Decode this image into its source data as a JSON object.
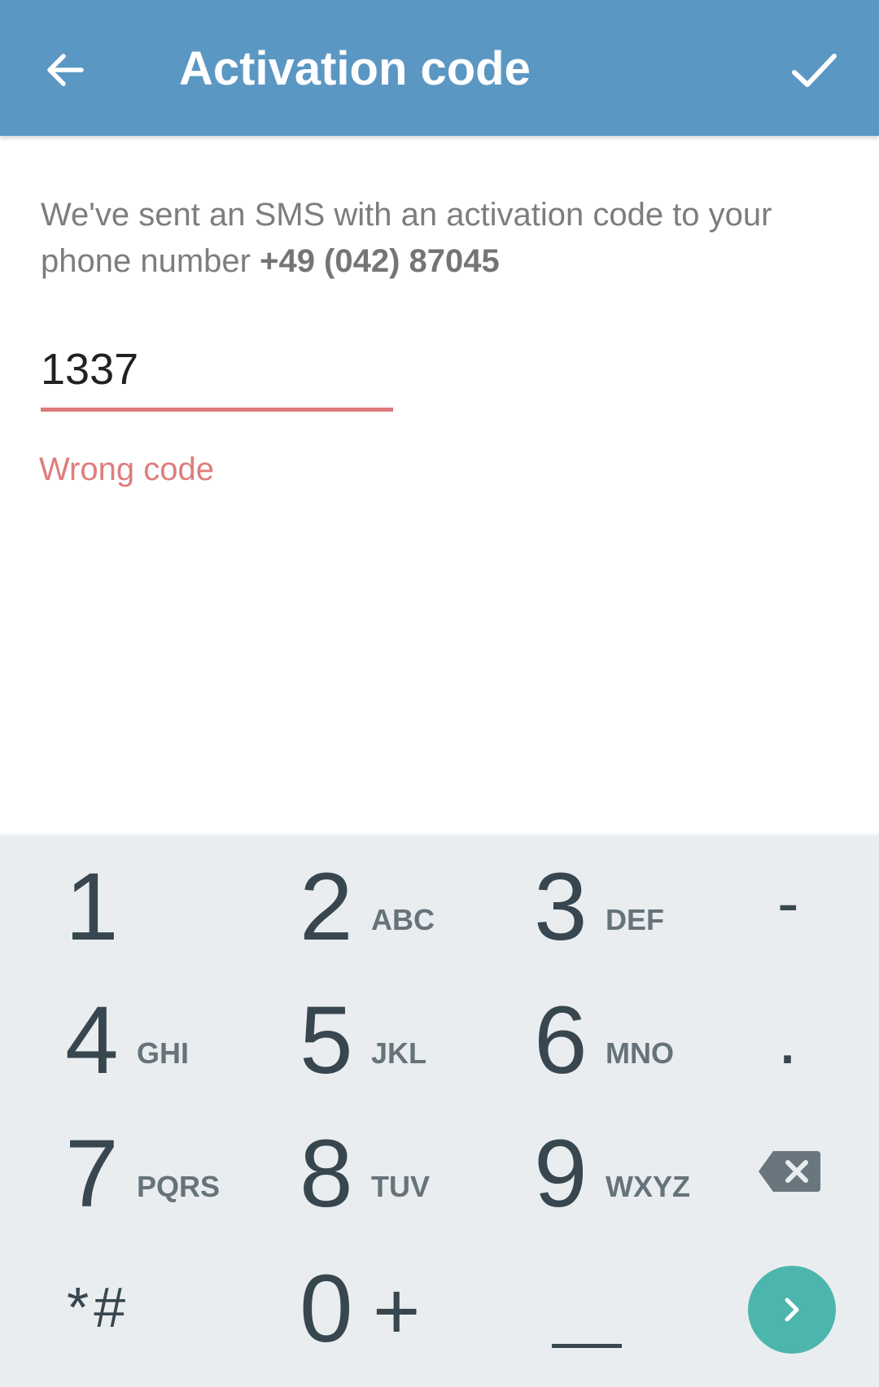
{
  "appbar": {
    "back_icon": "arrow-back-icon",
    "title": "Activation code",
    "done_icon": "check-icon",
    "background_color": "#5b97c3"
  },
  "content": {
    "message_prefix": "We've sent an SMS with an activation code to your phone number",
    "phone_number": "+49 (042) 87045",
    "code_value": "1337",
    "error_text": "Wrong code",
    "error_color": "#df7d7d"
  },
  "keypad": {
    "keys": [
      {
        "digit": "1",
        "letters": ""
      },
      {
        "digit": "2",
        "letters": "ABC"
      },
      {
        "digit": "3",
        "letters": "DEF"
      },
      {
        "symbol": "-"
      },
      {
        "digit": "4",
        "letters": "GHI"
      },
      {
        "digit": "5",
        "letters": "JKL"
      },
      {
        "digit": "6",
        "letters": "MNO"
      },
      {
        "symbol": "."
      },
      {
        "digit": "7",
        "letters": "PQRS"
      },
      {
        "digit": "8",
        "letters": "TUV"
      },
      {
        "digit": "9",
        "letters": "WXYZ"
      },
      {
        "icon": "backspace-icon"
      },
      {
        "symbol": "*#"
      },
      {
        "digit": "0",
        "letters": "+"
      },
      {
        "symbol": "space-bar-icon"
      },
      {
        "icon": "chevron-right-icon"
      }
    ],
    "accent_color": "#4db6ac"
  }
}
